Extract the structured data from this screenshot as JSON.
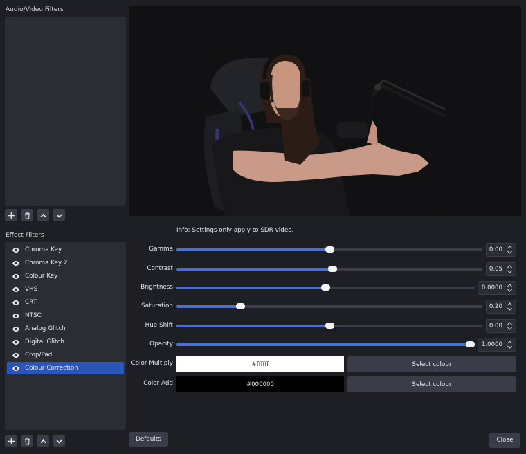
{
  "audio_video": {
    "title": "Audio/Video Filters"
  },
  "effect": {
    "title": "Effect Filters",
    "items": [
      {
        "label": "Chroma Key"
      },
      {
        "label": "Chroma Key 2"
      },
      {
        "label": "Colour Key"
      },
      {
        "label": "VHS"
      },
      {
        "label": "CRT"
      },
      {
        "label": "NTSC"
      },
      {
        "label": "Analog Glitch"
      },
      {
        "label": "Digital Glitch"
      },
      {
        "label": "Crop/Pad"
      },
      {
        "label": "Colour Correction"
      }
    ],
    "selected_index": 9
  },
  "toolbar_icons": [
    "plus-icon",
    "trash-icon",
    "chevron-up-icon",
    "chevron-down-icon"
  ],
  "settings": {
    "info": "Info: Settings only apply to SDR video.",
    "sliders": [
      {
        "label": "Gamma",
        "value": "0.00",
        "level": 0.5
      },
      {
        "label": "Contrast",
        "value": "0.05",
        "level": 0.51
      },
      {
        "label": "Brightness",
        "value": "0.0000",
        "level": 0.5
      },
      {
        "label": "Saturation",
        "value": "0.20",
        "level": 0.2
      },
      {
        "label": "Hue Shift",
        "value": "0.00",
        "level": 0.5
      },
      {
        "label": "Opacity",
        "value": "1.0000",
        "level": 1.0
      }
    ],
    "colors": [
      {
        "label": "Color Multiply",
        "hex": "#ffffff",
        "button": "Select colour"
      },
      {
        "label": "Color Add",
        "hex": "#000000",
        "button": "Select colour"
      }
    ]
  },
  "buttons": {
    "defaults": "Defaults",
    "close": "Close"
  },
  "theme": {
    "accent": "#4a6fd4",
    "selection": "#2c55b8",
    "background": "#1e1f24",
    "panel": "#2b2d35"
  }
}
